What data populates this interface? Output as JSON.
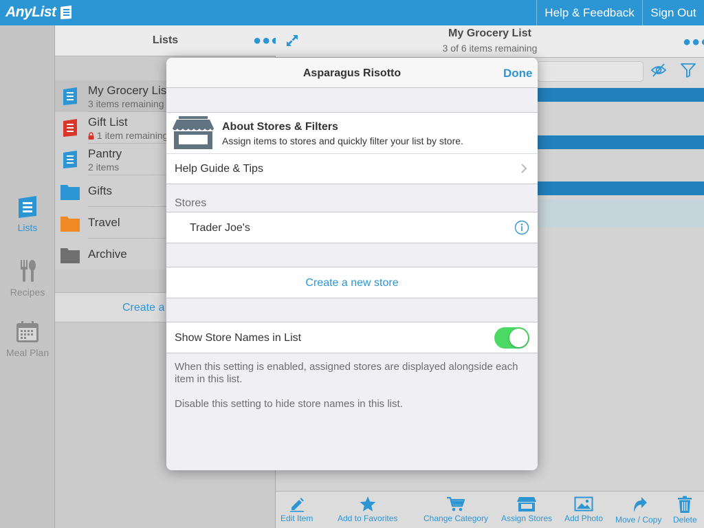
{
  "app": {
    "name": "AnyList"
  },
  "topbar": {
    "help_label": "Help & Feedback",
    "signout_label": "Sign Out"
  },
  "rail": {
    "items": [
      {
        "label": "Lists",
        "icon": "list-icon",
        "active": true
      },
      {
        "label": "Recipes",
        "icon": "fork-spoon-icon",
        "active": false
      },
      {
        "label": "Meal Plan",
        "icon": "calendar-icon",
        "active": false
      }
    ]
  },
  "lists_pane": {
    "title": "Lists",
    "items": [
      {
        "name": "My Grocery List",
        "subtitle": "3 items remaining",
        "icon": "grocery-list-icon"
      },
      {
        "name": "Gift List",
        "subtitle": "1 item remaining",
        "icon": "gift-list-icon",
        "locked": true
      },
      {
        "name": "Pantry",
        "subtitle": "2 items",
        "icon": "pantry-list-icon"
      },
      {
        "name": "Gifts",
        "icon": "folder-icon",
        "color": "#2c95d3"
      },
      {
        "name": "Travel",
        "icon": "folder-icon",
        "color": "#f08a24"
      },
      {
        "name": "Archive",
        "icon": "folder-icon",
        "color": "#707070"
      }
    ],
    "create_label": "Create a"
  },
  "main_pane": {
    "title": "My Grocery List",
    "subtitle": "3 of 6 items remaining",
    "toolbar": [
      {
        "label": "Edit Item",
        "icon": "pencil-icon"
      },
      {
        "label": "Add to Favorites",
        "icon": "star-icon"
      },
      {
        "label": "Change Category",
        "icon": "cart-icon"
      },
      {
        "label": "Assign Stores",
        "icon": "store-icon"
      },
      {
        "label": "Add Photo",
        "icon": "photo-icon"
      },
      {
        "label": "Move / Copy",
        "icon": "move-arrow-icon"
      },
      {
        "label": "Delete",
        "icon": "trash-icon"
      }
    ]
  },
  "popover": {
    "title": "Asparagus Risotto",
    "done_label": "Done",
    "about": {
      "title": "About Stores & Filters",
      "subtitle": "Assign items to stores and quickly filter your list by store."
    },
    "help_label": "Help Guide & Tips",
    "stores_header": "Stores",
    "stores": [
      {
        "name": "Trader Joe's"
      }
    ],
    "create_store_label": "Create a new store",
    "toggle_label": "Show Store Names in List",
    "toggle_on": true,
    "footer_1": "When this setting is enabled, assigned stores are displayed alongside each item in this list.",
    "footer_2": "Disable this setting to hide store names in this list."
  },
  "colors": {
    "accent": "#2c95d3",
    "toggle_on": "#4cd964",
    "gift_red": "#d9352b"
  }
}
